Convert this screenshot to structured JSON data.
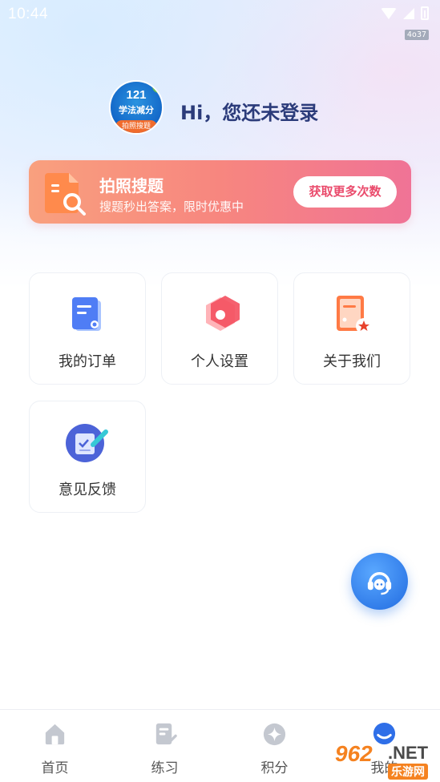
{
  "status_bar": {
    "time": "10:44",
    "network_badge": "4o37"
  },
  "profile": {
    "avatar": {
      "number": "121",
      "line1": "学法减分",
      "line2": "拍照搜题"
    },
    "greeting": "Hi，您还未登录"
  },
  "banner": {
    "title": "拍照搜题",
    "subtitle": "搜题秒出答案，限时优惠中",
    "button": "获取更多次数",
    "colors": {
      "start": "#f9a07e",
      "end": "#f07396",
      "button_text": "#ea4b6c"
    }
  },
  "menu": {
    "items": [
      {
        "label": "我的订单",
        "icon": "order-icon"
      },
      {
        "label": "个人设置",
        "icon": "settings-icon"
      },
      {
        "label": "关于我们",
        "icon": "about-icon"
      },
      {
        "label": "意见反馈",
        "icon": "feedback-icon"
      }
    ]
  },
  "support": {
    "icon": "customer-service-icon"
  },
  "bottom_nav": {
    "items": [
      {
        "label": "首页",
        "icon": "home-icon"
      },
      {
        "label": "练习",
        "icon": "practice-icon"
      },
      {
        "label": "积分",
        "icon": "points-icon"
      },
      {
        "label": "我的",
        "icon": "profile-icon",
        "active": true
      }
    ]
  },
  "watermark": {
    "number": "962",
    "net": ".NET",
    "cn": "乐游网"
  }
}
